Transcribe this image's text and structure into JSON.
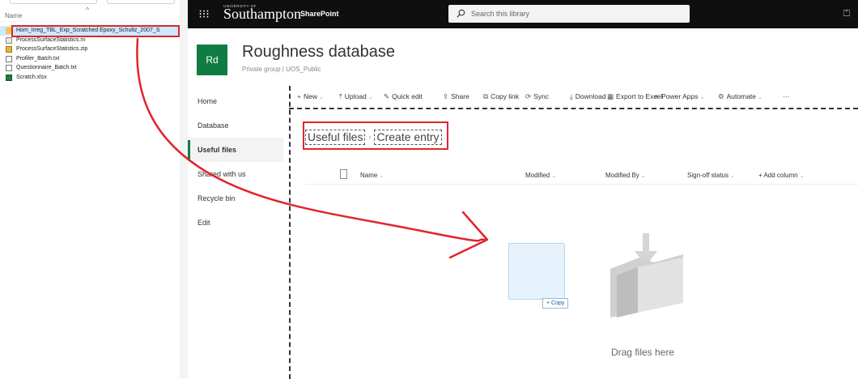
{
  "explorer": {
    "column_name": "Name",
    "sort_indicator": "^",
    "files": [
      {
        "name": "Hom_Irreg_TBL_Exp_Scratched Epoxy_Schultz_2007_S",
        "type": "folder"
      },
      {
        "name": "ProcessSurfaceStatistics.m",
        "type": "m"
      },
      {
        "name": "ProcessSurfaceStatistics.zip",
        "type": "zip"
      },
      {
        "name": "Profiler_Batch.txt",
        "type": "txt"
      },
      {
        "name": "Questionnaire_Batch.txt",
        "type": "txt"
      },
      {
        "name": "Scratch.xlsx",
        "type": "xlsx"
      }
    ]
  },
  "suitebar": {
    "waffle_glyph": "⁝⁝⁝",
    "brand_top": "UNIVERSITY OF",
    "brand": "Southampton",
    "app": "SharePoint",
    "search_placeholder": "Search this library",
    "right_glyph": "⏍"
  },
  "site": {
    "logo_text": "Rd",
    "title": "Roughness database",
    "subtitle": "Private group | UOS_Public",
    "logo_color": "#107c41"
  },
  "nav": {
    "items": [
      "Home",
      "Database",
      "Useful files",
      "Shared with us",
      "Recycle bin",
      "Edit"
    ],
    "active": "Useful files"
  },
  "commands": [
    {
      "glyph": "+",
      "label": "New",
      "chev": true
    },
    {
      "glyph": "⤒",
      "label": "Upload",
      "chev": true
    },
    {
      "glyph": "✎",
      "label": "Quick edit",
      "chev": false
    },
    {
      "glyph": "⇪",
      "label": "Share",
      "chev": false
    },
    {
      "glyph": "⧉",
      "label": "Copy link",
      "chev": false
    },
    {
      "glyph": "⟳",
      "label": "Sync",
      "chev": false
    },
    {
      "glyph": "⤓",
      "label": "Download",
      "chev": false
    },
    {
      "glyph": "▦",
      "label": "Export to Excel",
      "chev": false
    },
    {
      "glyph": "⚭",
      "label": "Power Apps",
      "chev": true
    },
    {
      "glyph": "⚙",
      "label": "Automate",
      "chev": true
    },
    {
      "glyph": "",
      "label": "···",
      "chev": false
    }
  ],
  "breadcrumb": {
    "items": [
      "Useful files",
      "Create entry"
    ],
    "separator": "›"
  },
  "columns": {
    "name": "Name",
    "modified": "Modified",
    "modified_by": "Modified By",
    "signoff": "Sign-off status",
    "add_column": "+ Add column"
  },
  "drop": {
    "copy_label": "+ Copy",
    "empty_text": "Drag files here"
  },
  "annotation_color": "#e0262d"
}
